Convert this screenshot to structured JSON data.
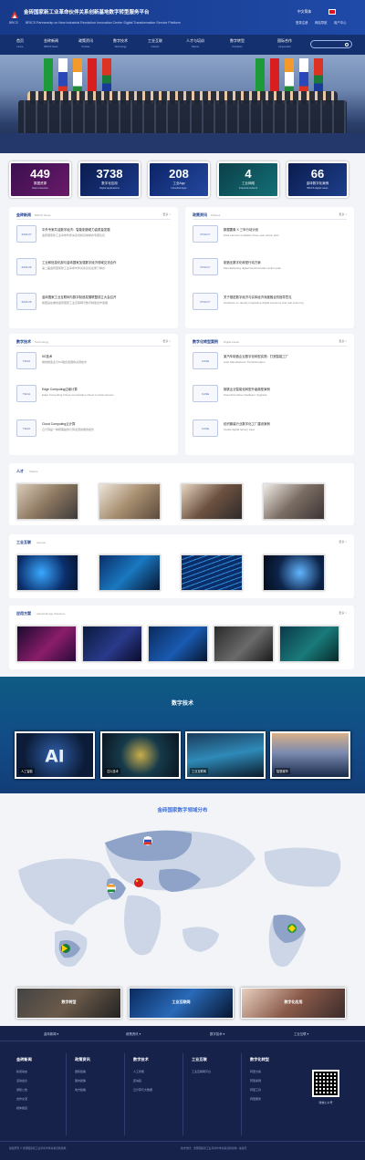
{
  "header": {
    "title": "金砖国家新工业革命伙伴关系创新基地数字转型服务平台",
    "subtitle": "BRICS Partnership on New Industrial Revolution Innovation Center Digital Transformation Service Platform",
    "prefix": "BRICS",
    "language": "中文简体",
    "links": [
      "登录注册",
      "网站导航",
      "用户中心"
    ]
  },
  "nav": {
    "items": [
      {
        "cn": "首页",
        "en": "Home"
      },
      {
        "cn": "金砖新闻",
        "en": "BRICS News"
      },
      {
        "cn": "政策资讯",
        "en": "Policies"
      },
      {
        "cn": "数字技术",
        "en": "Technology"
      },
      {
        "cn": "工业互联",
        "en": "Internet"
      },
      {
        "cn": "人才与培训",
        "en": "Talents"
      },
      {
        "cn": "数字转型",
        "en": "Transform"
      },
      {
        "cn": "国际合作",
        "en": "Cooperation"
      }
    ]
  },
  "stats": [
    {
      "value": "449",
      "label": "数据资源",
      "sub": "Data resources",
      "color": "#5a1a6a"
    },
    {
      "value": "3738",
      "label": "数字化应用",
      "sub": "Digital applications",
      "color": "#102a6e"
    },
    {
      "value": "208",
      "label": "工业App",
      "sub": "Industrial Apps",
      "color": "#14307c"
    },
    {
      "value": "4",
      "label": "工业网络",
      "sub": "Industrial network",
      "color": "#0f5a62"
    },
    {
      "value": "66",
      "label": "金砖数字化案例",
      "sub": "BRICS digital cases",
      "color": "#102a6e"
    }
  ],
  "panels": {
    "news": {
      "title": "金砖新闻",
      "title_en": "BRICS News",
      "more": "更多 >",
      "items": [
        {
          "icon": "2023-07",
          "t": "中外专家共话数字经济：智能制造助力高质量发展",
          "d": "金砖国家新工业革命伙伴关系创新基地举办专题论坛"
        },
        {
          "icon": "2023-06",
          "t": "工业和信息化部与金砖国家加强数字经济领域交流合作",
          "d": "第二届金砖国家新工业革命伙伴关系论坛在厦门举办"
        },
        {
          "icon": "2023-05",
          "t": "金砖国家工业互联网与数字制造发展联盟成立大会召开",
          "d": "联盟旨在推动金砖国家工业互联网与数字制造合作发展"
        }
      ]
    },
    "policy": {
      "title": "政策资讯",
      "title_en": "Policies",
      "more": "更多 >",
      "items": [
        {
          "icon": "POLICY",
          "t": "数据要素 X 三年行动计划",
          "d": "Data element multiplier three-year action plan"
        },
        {
          "icon": "POLICY",
          "t": "制造业数字化转型行动方案",
          "d": "Manufacturing digital transformation action plan"
        },
        {
          "icon": "POLICY",
          "t": "关于推进数字经济与实体经济深度融合的指导意见",
          "d": "Guidance on deeply integrating digital economy and real economy"
        }
      ]
    },
    "tech": {
      "title": "数字技术",
      "title_en": "Technology",
      "more": "更多 >",
      "items": [
        {
          "icon": "TECH",
          "t": "5G技术",
          "d": "推动制造业与5G融合发展的关键技术"
        },
        {
          "icon": "TECH",
          "t": "Edge Computing边缘计算",
          "d": "Edge Computing brings computation closer to data sources"
        },
        {
          "icon": "TECH",
          "t": "Cloud Computing云计算",
          "d": "云计算是一种按需提供计算资源的服务模式"
        }
      ]
    },
    "cases": {
      "title": "数字化转型案例",
      "title_en": "Digital cases",
      "more": "更多 >",
      "items": [
        {
          "icon": "CASE",
          "t": "某汽车制造企业数字化转型实践：打造智能工厂",
          "d": "Auto Manufacturer Transformation"
        },
        {
          "icon": "CASE",
          "t": "钢铁企业智能化转型升级典型案例",
          "d": "Steel Enterprise Intelligent Upgrade"
        },
        {
          "icon": "CASE",
          "t": "纺织服装行业数字化工厂建设案例",
          "d": "Textile digital factory case"
        }
      ]
    }
  },
  "sections": {
    "talent": {
      "title": "人才",
      "title_en": "Talents"
    },
    "industry": {
      "title": "工业互联",
      "title_en": "Internet",
      "more": "更多 >"
    },
    "apps": {
      "title": "应用方案",
      "title_en": "Industrial App Solutions",
      "more": "更多 >"
    }
  },
  "digital": {
    "title": "数字技术",
    "cards": [
      "人工智能",
      "芯片技术",
      "工业互联网",
      "智慧城市"
    ]
  },
  "map": {
    "title": "金砖国家数字领域分布"
  },
  "bottom_cards": [
    "数字转型",
    "工业互联网",
    "数字化应用"
  ],
  "footer": {
    "top_links": [
      "金砖新闻 ▾",
      "政策资讯 ▾",
      "数字技术 ▾",
      "工业互联 ▾"
    ],
    "columns": [
      {
        "title": "金砖新闻",
        "items": [
          "新闻动态",
          "活动会议",
          "通知公告",
          "合作交流",
          "媒体报道"
        ]
      },
      {
        "title": "政策资讯",
        "items": [
          "国际政策",
          "国内政策",
          "地方政策"
        ]
      },
      {
        "title": "数字技术",
        "items": [
          "人工智能",
          "区块链",
          "云计算与大数据"
        ]
      },
      {
        "title": "工业互联",
        "items": [
          "工业互联网平台"
        ]
      },
      {
        "title": "数字化转型",
        "items": [
          "转型方案",
          "转型案例",
          "转型工具",
          "转型服务"
        ]
      }
    ],
    "qr_caption": "微信公众号",
    "copyright": "版权所有 © 金砖国家新工业革命伙伴关系创新基地",
    "copyright_right": "技术支持：金砖国家新工业革命伙伴关系创新基地 · 备案号"
  }
}
